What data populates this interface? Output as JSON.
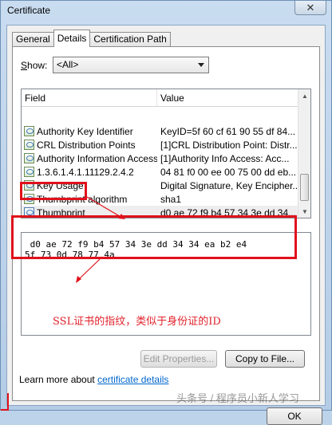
{
  "window": {
    "title": "Certificate",
    "close_glyph": "✕"
  },
  "tabs": [
    {
      "label": "General",
      "active": false
    },
    {
      "label": "Details",
      "active": true
    },
    {
      "label": "Certification Path",
      "active": false
    }
  ],
  "show": {
    "label_prefix": "",
    "label_mnemonic": "S",
    "label_rest": "how:",
    "selected": "<All>"
  },
  "list": {
    "headers": {
      "field": "Field",
      "value": "Value"
    },
    "rows": [
      {
        "field": "Authority Key Identifier",
        "value": "KeyID=5f 60 cf 61 90 55 df 84...",
        "icon": "certificate-field-icon"
      },
      {
        "field": "CRL Distribution Points",
        "value": "[1]CRL Distribution Point: Distr...",
        "icon": "certificate-field-icon"
      },
      {
        "field": "Authority Information Access",
        "value": "[1]Authority Info Access: Acc...",
        "icon": "certificate-field-icon"
      },
      {
        "field": "1.3.6.1.4.1.11129.2.4.2",
        "value": "04 81 f0 00 ee 00 75 00 dd eb...",
        "icon": "certificate-field-icon"
      },
      {
        "field": "Key Usage",
        "value": "Digital Signature, Key Encipher...",
        "icon": "certificate-field-icon"
      },
      {
        "field": "Thumbprint algorithm",
        "value": "sha1",
        "icon": "certificate-field-icon"
      },
      {
        "field": "Thumbprint",
        "value": "d0 ae 72 f9 b4 57 34 3e dd 34...",
        "icon": "thumbprint-icon"
      }
    ]
  },
  "value_box": {
    "line1": " d0 ae 72 f9 b4 57 34 3e dd 34 34 ea b2 e4",
    "line2": "5f 73 0d 78 77 4a"
  },
  "annotation": {
    "text": "SSL证书的指纹，类似于身份证的ID",
    "color": "#e0222b"
  },
  "buttons": {
    "edit": "Edit Properties...",
    "copy": "Copy to File...",
    "ok": "OK"
  },
  "learn": {
    "prefix": "Learn more about ",
    "link": "certificate details"
  },
  "watermark": "头条号 / 程序员小新人学习",
  "colors": {
    "annotation_red": "#e0111b",
    "link_blue": "#0066cc"
  }
}
